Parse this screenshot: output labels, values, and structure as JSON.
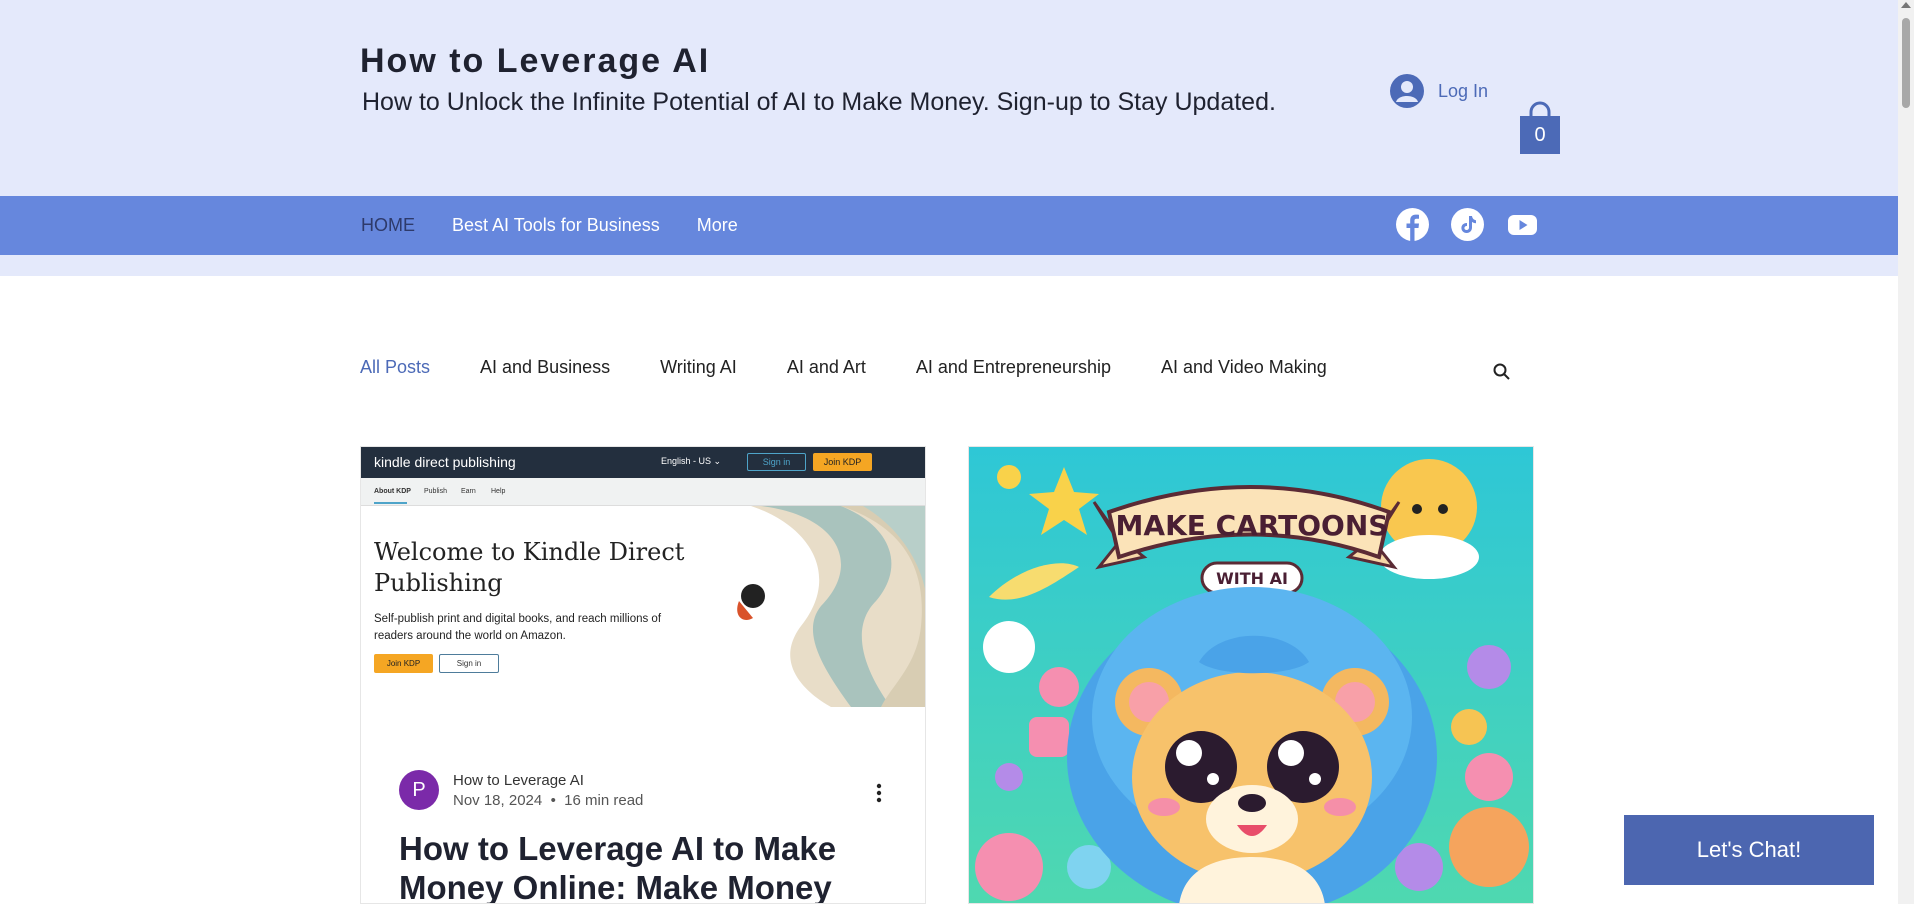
{
  "site": {
    "title": "How to Leverage AI",
    "tagline": "How to Unlock the Infinite Potential of AI to Make Money. Sign-up to Stay Updated.",
    "login_label": "Log In",
    "cart_count": "0"
  },
  "nav": {
    "items": [
      {
        "label": "HOME",
        "active": true
      },
      {
        "label": "Best AI Tools for Business",
        "active": false
      },
      {
        "label": "More",
        "active": false
      }
    ]
  },
  "social": [
    "facebook-icon",
    "tiktok-icon",
    "youtube-icon"
  ],
  "categories": {
    "items": [
      {
        "label": "All Posts",
        "active": true
      },
      {
        "label": "AI and Business",
        "active": false
      },
      {
        "label": "Writing AI",
        "active": false
      },
      {
        "label": "AI and Art",
        "active": false
      },
      {
        "label": "AI and Entrepreneurship",
        "active": false
      },
      {
        "label": "AI and Video Making",
        "active": false
      }
    ]
  },
  "posts": [
    {
      "image": {
        "logo": "kindle direct publishing",
        "lang": "English - US ⌄",
        "signin_top": "Sign in",
        "join_top": "Join KDP",
        "subnav": [
          "About KDP",
          "Publish",
          "Earn",
          "Help"
        ],
        "heading": "Welcome to Kindle Direct Publishing",
        "desc": "Self-publish print and digital books, and reach millions of readers around the world on Amazon.",
        "join": "Join KDP",
        "signin": "Sign in"
      },
      "avatar_letter": "P",
      "author": "How to Leverage AI",
      "date": "Nov 18, 2024",
      "read_time": "16 min read",
      "title": "How to Leverage AI to Make Money Online: Make Money"
    },
    {
      "image": {
        "banner": "MAKE CARTOONS",
        "sub_banner": "WITH AI"
      }
    }
  ],
  "chat": {
    "label": "Let's Chat!"
  },
  "colors": {
    "header_bg": "#e4e9fb",
    "nav_bg": "#6687dd",
    "accent": "#4c6ab7",
    "chat_bg": "#4c66b0"
  }
}
